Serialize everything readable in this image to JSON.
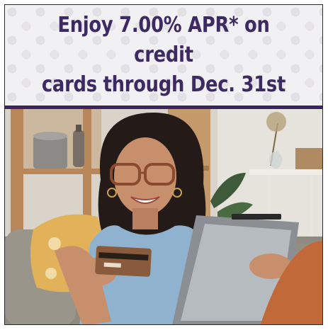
{
  "promo": {
    "headline_line1": "Enjoy 7.00% APR* on credit",
    "headline_line2": "cards through Dec. 31st",
    "accent_color": "#3e2a63"
  },
  "photo": {
    "subject": "smiling-woman-with-credit-card-and-tablet"
  }
}
